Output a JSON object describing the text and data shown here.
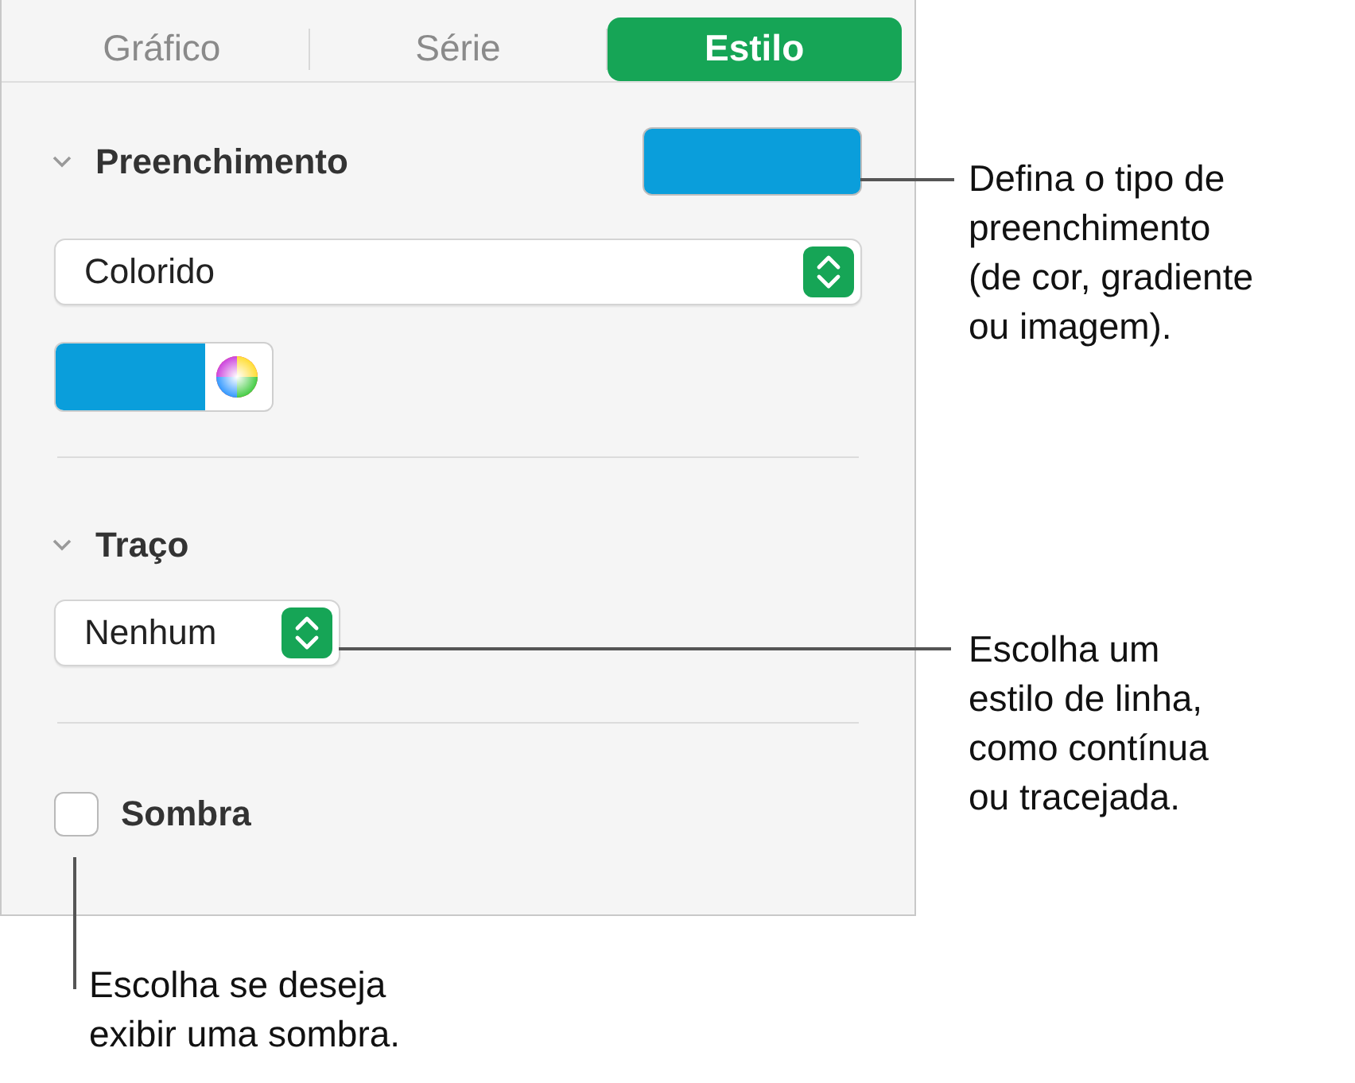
{
  "tabs": [
    {
      "label": "Gráfico",
      "selected": false
    },
    {
      "label": "Série",
      "selected": false
    },
    {
      "label": "Estilo",
      "selected": true
    }
  ],
  "fill": {
    "title": "Preenchimento",
    "expanded": true,
    "color": "#0a9edb",
    "popup": "Colorido"
  },
  "stroke": {
    "title": "Traço",
    "expanded": true,
    "popup": "Nenhum"
  },
  "shadow": {
    "label": "Sombra",
    "checked": false
  },
  "callouts": [
    {
      "lines": [
        "Defina o tipo de",
        "preenchimento",
        "(de cor, gradiente",
        "ou imagem)."
      ]
    },
    {
      "lines": [
        "Escolha um",
        "estilo de linha,",
        "como contínua",
        "ou tracejada."
      ]
    },
    {
      "lines": [
        "Escolha se deseja",
        "exibir uma sombra."
      ]
    }
  ]
}
